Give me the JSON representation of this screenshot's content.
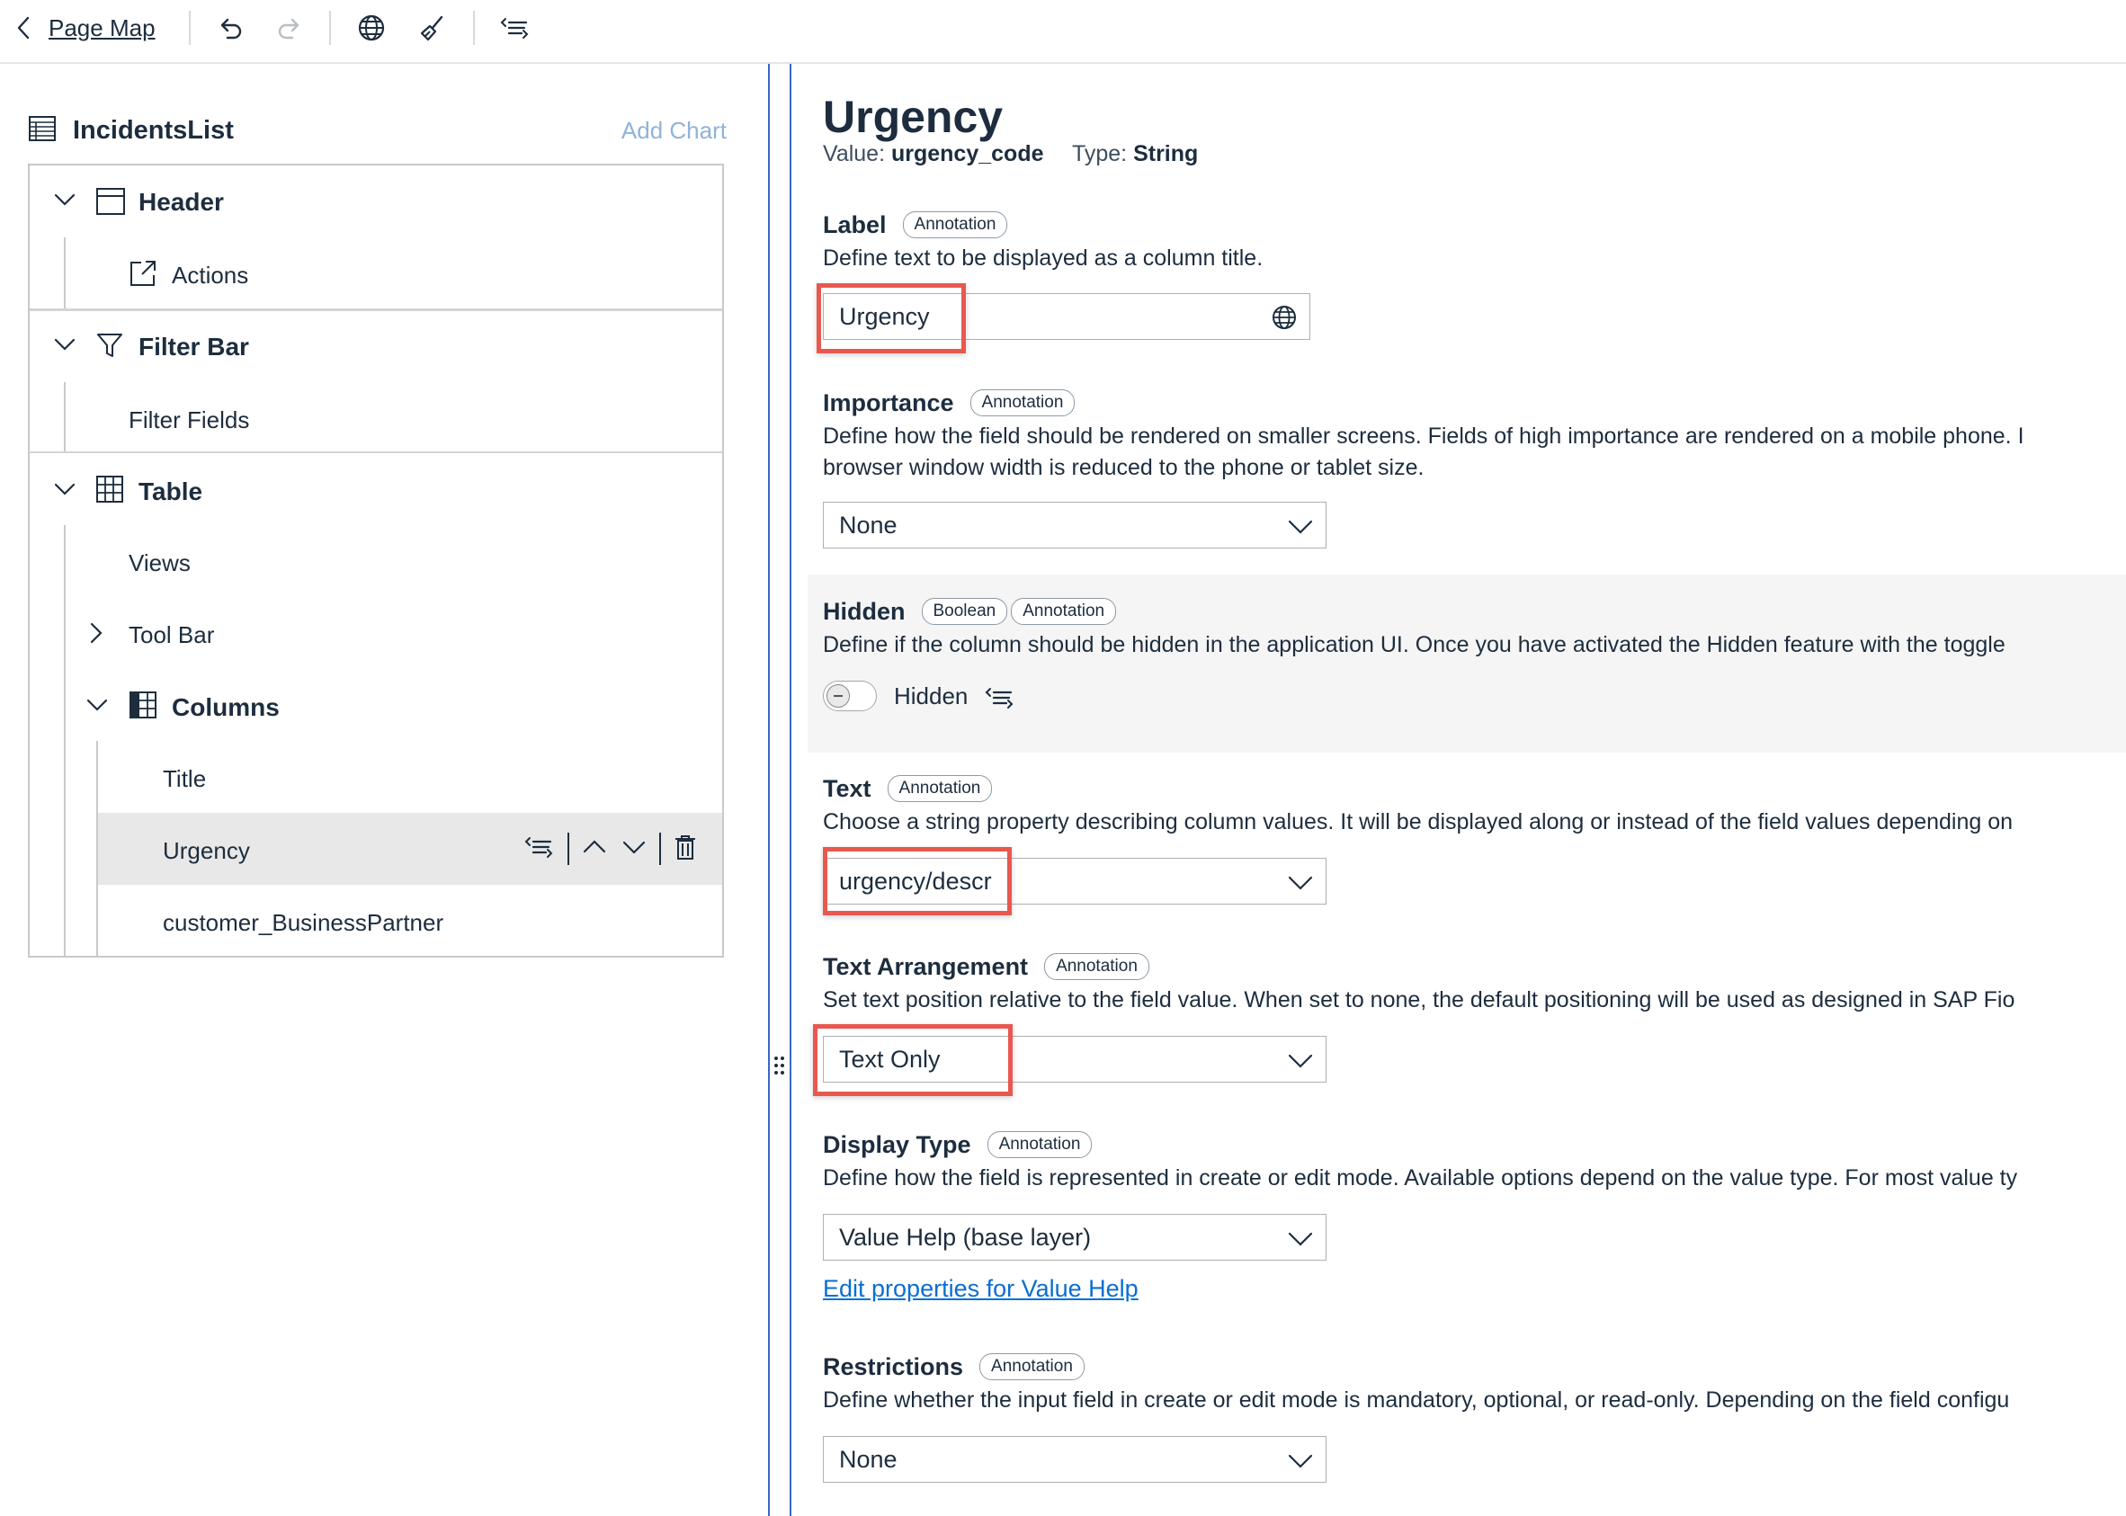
{
  "toolbar": {
    "back_label": "Page Map",
    "icons": [
      "undo-icon",
      "redo-icon",
      "globe-icon",
      "broom-icon",
      "outline-icon"
    ]
  },
  "left": {
    "page_name": "IncidentsList",
    "add_chart": "Add Chart",
    "tree": {
      "header": "Header",
      "actions": "Actions",
      "filter_bar": "Filter Bar",
      "filter_fields": "Filter Fields",
      "table": "Table",
      "views": "Views",
      "tool_bar": "Tool Bar",
      "columns": "Columns",
      "col_title": "Title",
      "col_urgency": "Urgency",
      "col_customer": "customer_BusinessPartner"
    }
  },
  "right": {
    "title": "Urgency",
    "value_key": "Value:",
    "value": "urgency_code",
    "type_key": "Type:",
    "type": "String",
    "props": {
      "label": {
        "name": "Label",
        "badge": "Annotation",
        "desc": "Define text to be displayed as a column title.",
        "value": "Urgency"
      },
      "importance": {
        "name": "Importance",
        "badge": "Annotation",
        "desc1": "Define how the field should be rendered on smaller screens. Fields of high importance are rendered on a mobile phone. I",
        "desc2": "browser window width is reduced to the phone or tablet size.",
        "value": "None"
      },
      "hidden": {
        "name": "Hidden",
        "badge1": "Boolean",
        "badge2": "Annotation",
        "desc": "Define if the column should be hidden in the application UI. Once you have activated the Hidden feature with the toggle",
        "toggle_label": "Hidden",
        "toggle_on": false
      },
      "text": {
        "name": "Text",
        "badge": "Annotation",
        "desc": "Choose a string property describing column values. It will be displayed along or instead of the field values depending on",
        "value": "urgency/descr"
      },
      "text_arrangement": {
        "name": "Text Arrangement",
        "badge": "Annotation",
        "desc": "Set text position relative to the field value. When set to none, the default positioning will be used as designed in SAP Fio",
        "value": "Text Only"
      },
      "display_type": {
        "name": "Display Type",
        "badge": "Annotation",
        "desc": "Define how the field is represented in create or edit mode. Available options depend on the value type. For most value ty",
        "value": "Value Help (base layer)",
        "link": "Edit properties for Value Help"
      },
      "restrictions": {
        "name": "Restrictions",
        "badge": "Annotation",
        "desc": "Define whether the input field in create or edit mode is mandatory, optional, or read-only. Depending on the field configu",
        "value": "None"
      }
    }
  },
  "colors": {
    "text": "#1d2d3e",
    "highlight": "#e8584f",
    "splitter": "#3967c7",
    "link": "#0a6ed1",
    "add_chart": "#8fb3d9",
    "selected_row": "#e8e8e8"
  }
}
